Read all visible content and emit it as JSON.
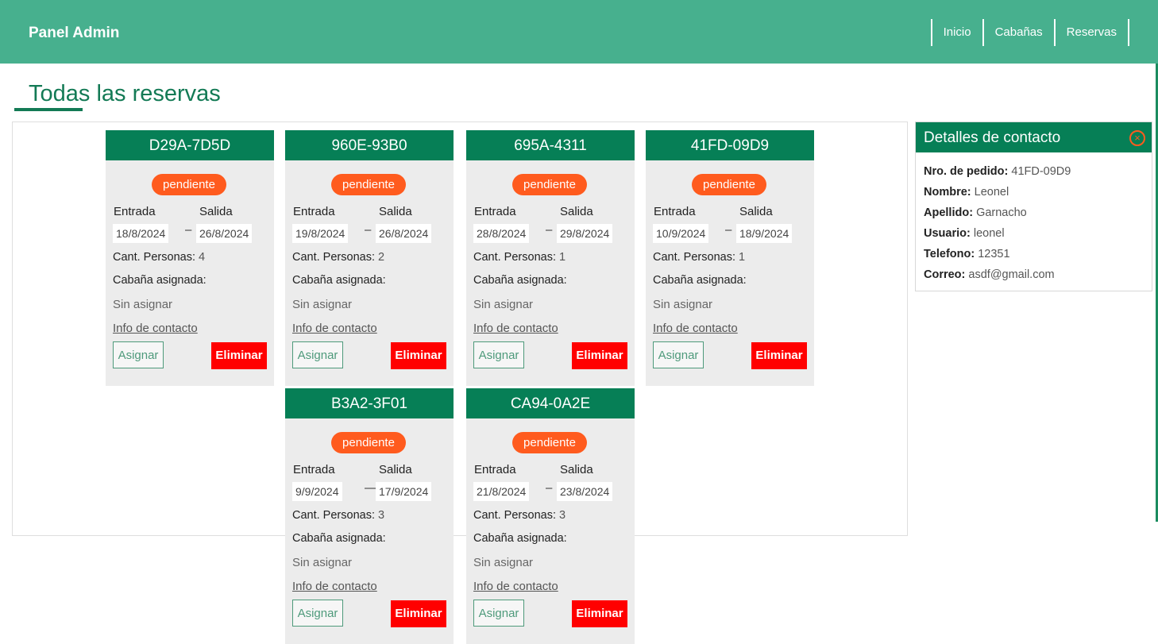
{
  "header": {
    "brand": "Panel Admin",
    "nav": [
      "Inicio",
      "Cabañas",
      "Reservas"
    ]
  },
  "page": {
    "title": "Todas las reservas"
  },
  "labels": {
    "entrada": "Entrada",
    "salida": "Salida",
    "personas": "Cant. Personas:",
    "cabana": "Cabaña asignada:",
    "info": "Info de contacto",
    "asignar": "Asignar",
    "eliminar": "Eliminar"
  },
  "reservas": [
    {
      "code": "D29A-7D5D",
      "status": "pendiente",
      "entrada": "18/8/2024",
      "sep": "–",
      "salida": "26/8/2024",
      "personas": "4",
      "cabana": "Sin asignar"
    },
    {
      "code": "960E-93B0",
      "status": "pendiente",
      "entrada": "19/8/2024",
      "sep": "–",
      "salida": "26/8/2024",
      "personas": "2",
      "cabana": "Sin asignar"
    },
    {
      "code": "695A-4311",
      "status": "pendiente",
      "entrada": "28/8/2024",
      "sep": "–",
      "salida": "29/8/2024",
      "personas": "1",
      "cabana": "Sin asignar"
    },
    {
      "code": "41FD-09D9",
      "status": "pendiente",
      "entrada": "10/9/2024",
      "sep": "–",
      "salida": "18/9/2024",
      "personas": "1",
      "cabana": "Sin asignar"
    },
    {
      "code": "B3A2-3F01",
      "status": "pendiente",
      "entrada": "9/9/2024",
      "sep": "—",
      "salida": "17/9/2024",
      "personas": "3",
      "cabana": "Sin asignar"
    },
    {
      "code": "CA94-0A2E",
      "status": "pendiente",
      "entrada": "21/8/2024",
      "sep": "–",
      "salida": "23/8/2024",
      "personas": "3",
      "cabana": "Sin asignar"
    }
  ],
  "contact": {
    "title": "Detalles de contacto",
    "rows": [
      {
        "label": "Nro. de pedido:",
        "value": "41FD-09D9"
      },
      {
        "label": "Nombre:",
        "value": "Leonel"
      },
      {
        "label": "Apellido:",
        "value": "Garnacho"
      },
      {
        "label": "Usuario:",
        "value": "leonel"
      },
      {
        "label": "Telefono:",
        "value": "12351"
      },
      {
        "label": "Correo:",
        "value": "asdf@gmail.com"
      }
    ]
  },
  "colors": {
    "header_bg": "#47b08e",
    "card_header": "#067f56",
    "badge": "#ff5b1e",
    "delete": "#ff0000"
  }
}
